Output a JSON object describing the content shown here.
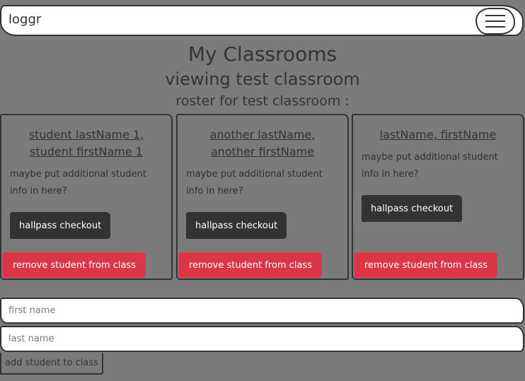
{
  "navbar": {
    "brand": "loggr",
    "toggler_icon": "hamburger-menu-icon"
  },
  "page": {
    "title": "My Classrooms",
    "subtitle": "viewing test classroom",
    "roster_heading": "roster for test classroom :"
  },
  "students": [
    {
      "name": "student lastName 1, student firstName 1",
      "info": "maybe put additional student info in here?",
      "checkout_label": "hallpass checkout",
      "remove_label": "remove student from class"
    },
    {
      "name": "another lastName, another firstName",
      "info": "maybe put additional student info in here?",
      "checkout_label": "hallpass checkout",
      "remove_label": "remove student from class"
    },
    {
      "name": "lastName, firstName",
      "info": "maybe put additional student info in here?",
      "checkout_label": "hallpass checkout",
      "remove_label": "remove student from class"
    }
  ],
  "form": {
    "first_name_placeholder": "first name",
    "last_name_placeholder": "last name",
    "add_label": "add student to class"
  },
  "colors": {
    "background": "#7b7b7b",
    "dark_button": "#333333",
    "danger_button": "#dc3545"
  }
}
